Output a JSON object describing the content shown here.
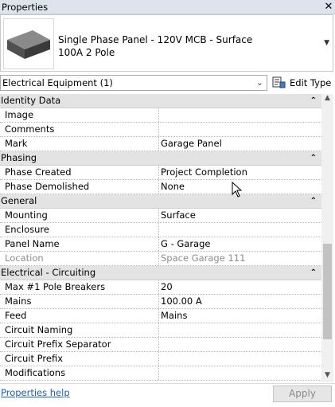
{
  "window": {
    "title": "Properties"
  },
  "type_selector": {
    "line1": "Single Phase Panel - 120V MCB - Surface",
    "line2": "100A 2 Pole"
  },
  "instance_filter": {
    "value": "Electrical Equipment (1)"
  },
  "edit_type": {
    "label": "Edit Type"
  },
  "groups": [
    {
      "name": "Identity Data",
      "params": [
        {
          "name": "Image",
          "value": ""
        },
        {
          "name": "Comments",
          "value": ""
        },
        {
          "name": "Mark",
          "value": "Garage Panel"
        }
      ]
    },
    {
      "name": "Phasing",
      "params": [
        {
          "name": "Phase Created",
          "value": "Project Completion"
        },
        {
          "name": "Phase Demolished",
          "value": "None"
        }
      ]
    },
    {
      "name": "General",
      "params": [
        {
          "name": "Mounting",
          "value": "Surface"
        },
        {
          "name": "Enclosure",
          "value": ""
        },
        {
          "name": "Panel Name",
          "value": "G - Garage"
        },
        {
          "name": "Location",
          "value": "Space Garage 111"
        }
      ]
    },
    {
      "name": "Electrical - Circuiting",
      "params": [
        {
          "name": "Max #1 Pole Breakers",
          "value": "20"
        },
        {
          "name": "Mains",
          "value": "100.00 A"
        },
        {
          "name": "Feed",
          "value": "Mains"
        },
        {
          "name": "Circuit Naming",
          "value": ""
        },
        {
          "name": "Circuit Prefix Separator",
          "value": ""
        },
        {
          "name": "Circuit Prefix",
          "value": ""
        },
        {
          "name": "Modifications",
          "value": ""
        }
      ]
    }
  ],
  "footer": {
    "help_link": "Properties help",
    "apply_label": "Apply"
  },
  "colors": {
    "link": "#1a5fb4",
    "category_bg": "#e3e3e3",
    "disabled_text": "#8d8d8d"
  }
}
